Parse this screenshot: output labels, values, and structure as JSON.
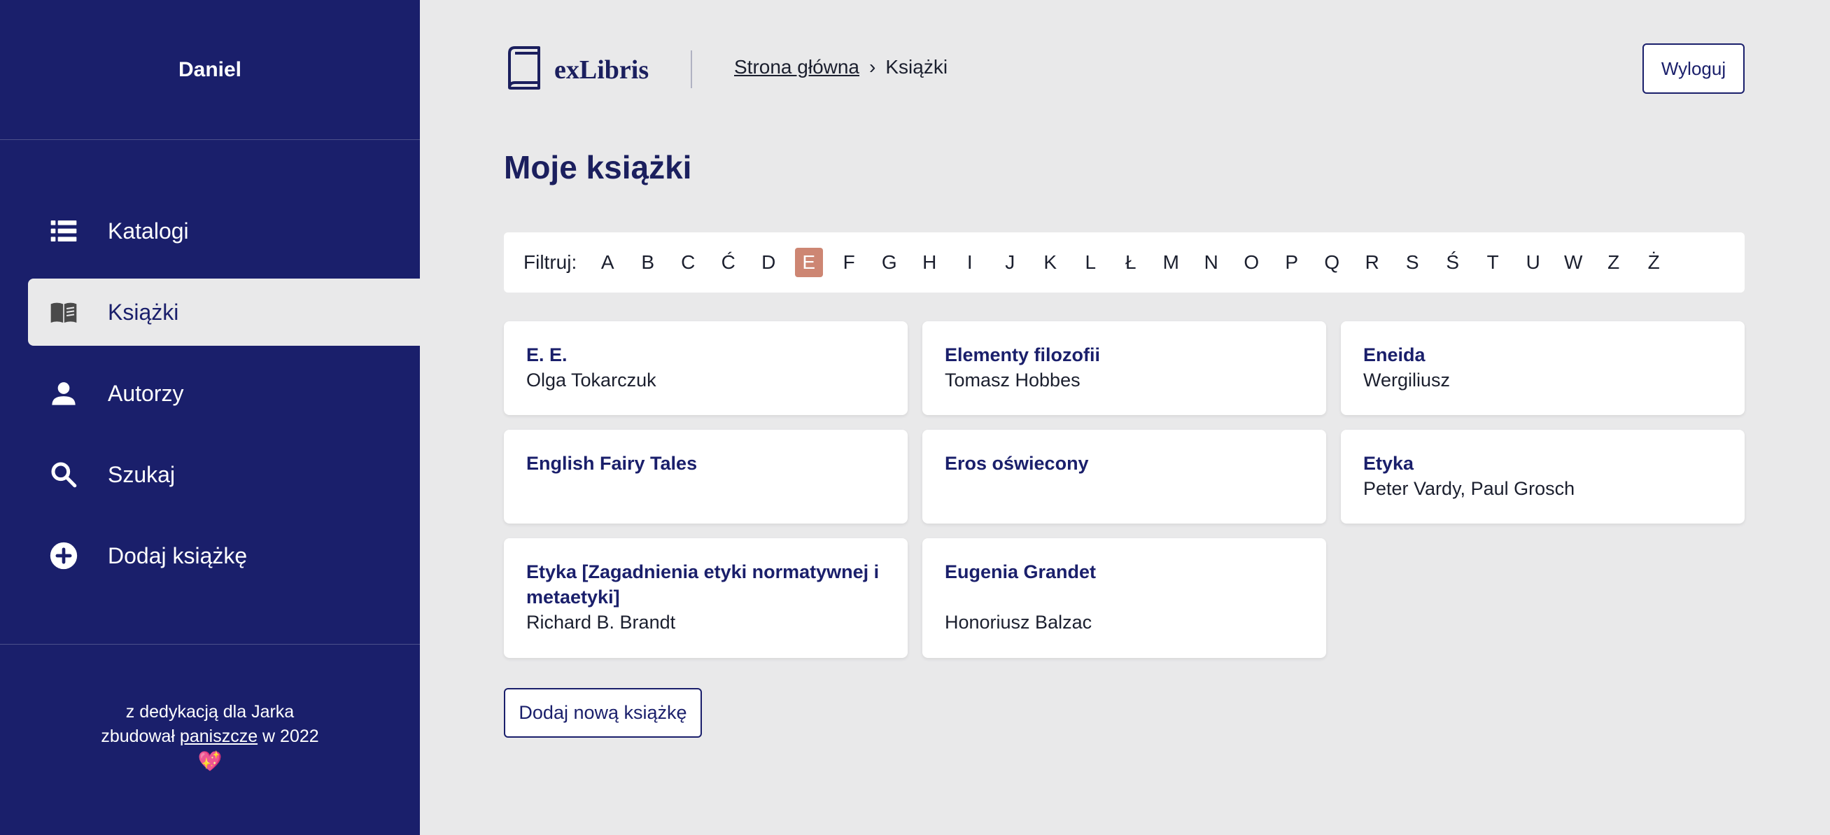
{
  "sidebar": {
    "user_name": "Daniel",
    "items": [
      {
        "label": "Katalogi",
        "icon": "list-icon",
        "active": false
      },
      {
        "label": "Książki",
        "icon": "book-open-icon",
        "active": true
      },
      {
        "label": "Autorzy",
        "icon": "person-icon",
        "active": false
      },
      {
        "label": "Szukaj",
        "icon": "search-icon",
        "active": false
      },
      {
        "label": "Dodaj książkę",
        "icon": "plus-circle-icon",
        "active": false
      }
    ],
    "footer": {
      "line1": "z dedykacją dla Jarka",
      "line2_prefix": "zbudował",
      "line2_link": "paniszcze",
      "line2_suffix": "w 2022",
      "emoji": "💖"
    }
  },
  "header": {
    "logo_text": "exLibris",
    "breadcrumb": {
      "home": "Strona główna",
      "separator": "›",
      "current": "Książki"
    },
    "logout_label": "Wyloguj"
  },
  "main": {
    "title": "Moje książki",
    "filter": {
      "label": "Filtruj:",
      "letters": [
        "A",
        "B",
        "C",
        "Ć",
        "D",
        "E",
        "F",
        "G",
        "H",
        "I",
        "J",
        "K",
        "L",
        "Ł",
        "M",
        "N",
        "O",
        "P",
        "Q",
        "R",
        "S",
        "Ś",
        "T",
        "U",
        "W",
        "Z",
        "Ż"
      ],
      "active": "E"
    },
    "books": [
      {
        "title": "E. E.",
        "author": "Olga Tokarczuk"
      },
      {
        "title": "Elementy filozofii",
        "author": "Tomasz Hobbes"
      },
      {
        "title": "Eneida",
        "author": "Wergiliusz"
      },
      {
        "title": "English Fairy Tales",
        "author": ""
      },
      {
        "title": "Eros oświecony",
        "author": ""
      },
      {
        "title": "Etyka",
        "author": "Peter Vardy, Paul Grosch"
      },
      {
        "title": "Etyka [Zagadnienia etyki normatywnej i metaetyki]",
        "author": "Richard B. Brandt"
      },
      {
        "title": "Eugenia Grandet",
        "author": "Honoriusz Balzac"
      }
    ],
    "add_button_label": "Dodaj nową książkę"
  },
  "colors": {
    "sidebar_bg": "#1a1f6b",
    "page_bg": "#e9e9ea",
    "accent_active_letter": "#cd8673",
    "title_color": "#1b1f5e"
  }
}
